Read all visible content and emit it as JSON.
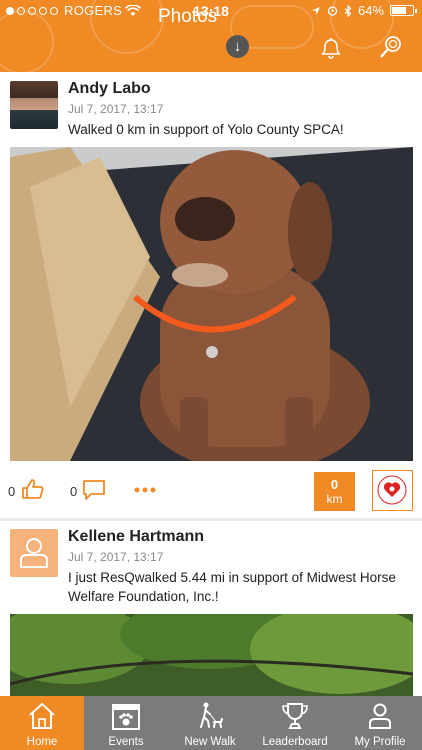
{
  "status_bar": {
    "carrier": "ROGERS",
    "time": "13:18",
    "battery": "64%"
  },
  "header": {
    "title": "Photos"
  },
  "posts": [
    {
      "name": "Andy Labo",
      "date": "Jul 7, 2017, 13:17",
      "text": "Walked 0 km in support of Yolo County SPCA!",
      "likes": "0",
      "comments": "0",
      "distance_value": "0",
      "distance_unit": "km"
    },
    {
      "name": "Kellene Hartmann",
      "date": "Jul 7, 2017, 13:17",
      "text": "I just ResQwalked 5.44 mi in support of Midwest Horse Welfare Foundation, Inc.!"
    }
  ],
  "tabs": [
    {
      "label": "Home"
    },
    {
      "label": "Events"
    },
    {
      "label": "New Walk"
    },
    {
      "label": "Leaderboard"
    },
    {
      "label": "My Profile"
    }
  ],
  "colors": {
    "accent": "#f08a24",
    "tabbar": "#7b7b7b"
  }
}
